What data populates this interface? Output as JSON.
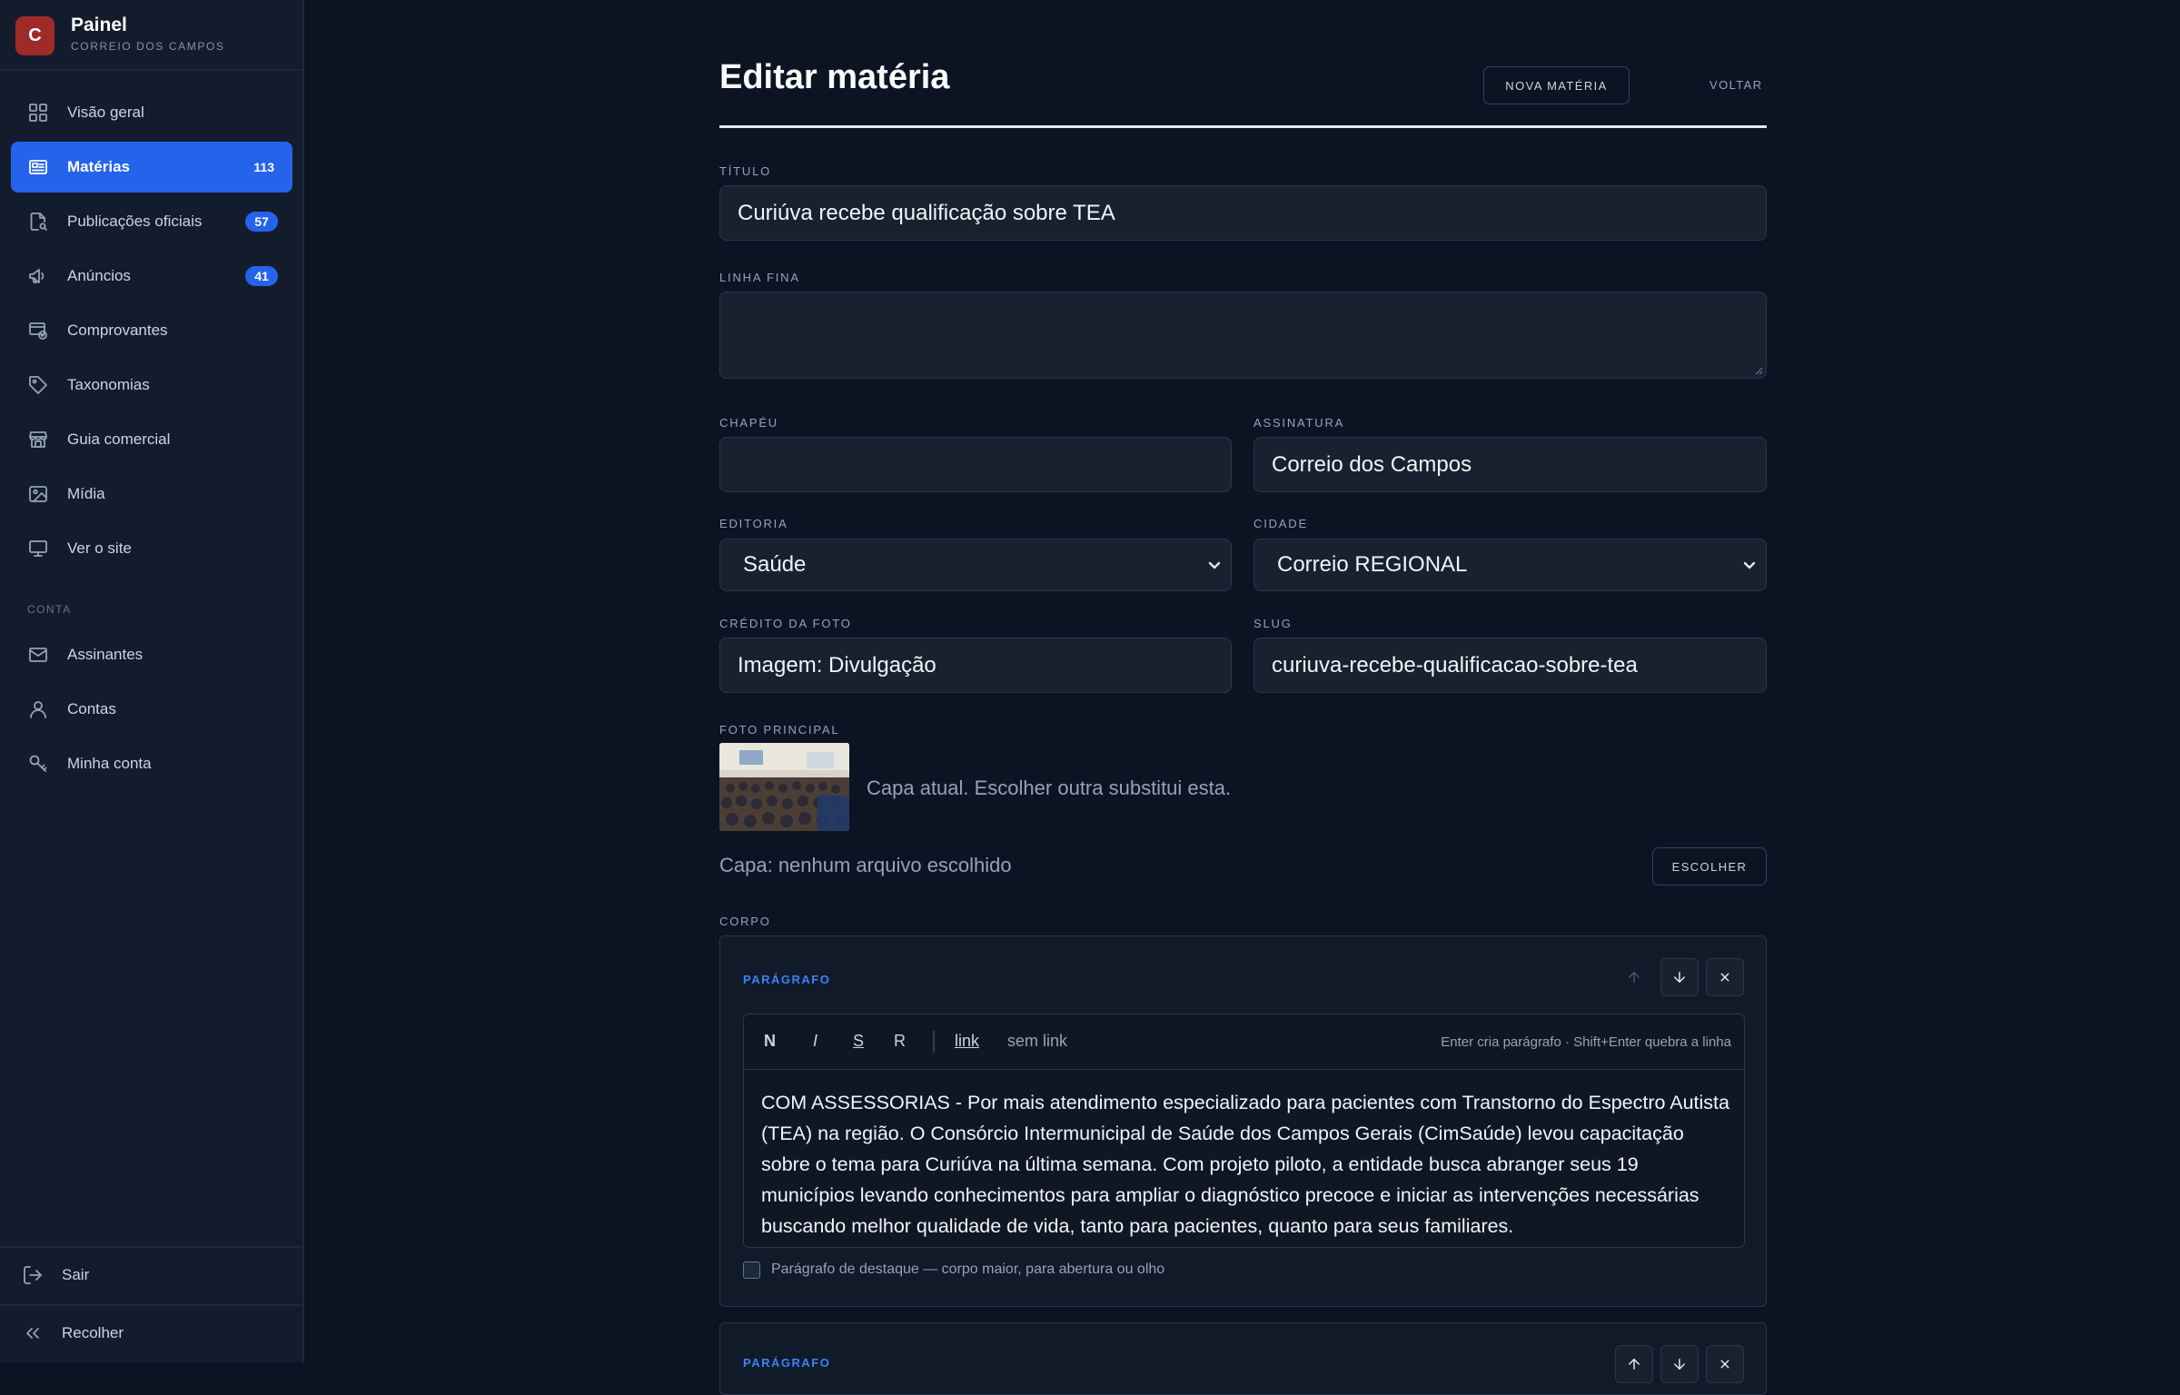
{
  "sidebar": {
    "brand": {
      "logo_letter": "C",
      "title": "Painel",
      "subtitle": "CORREIO DOS CAMPOS"
    },
    "items": [
      {
        "label": "Visão geral",
        "icon": "grid-icon"
      },
      {
        "label": "Matérias",
        "icon": "newspaper-icon",
        "badge": "113",
        "active": true
      },
      {
        "label": "Publicações oficiais",
        "icon": "document-search-icon",
        "badge": "57"
      },
      {
        "label": "Anúncios",
        "icon": "megaphone-icon",
        "badge": "41"
      },
      {
        "label": "Comprovantes",
        "icon": "receipt-icon"
      },
      {
        "label": "Taxonomias",
        "icon": "tag-icon"
      },
      {
        "label": "Guia comercial",
        "icon": "store-icon"
      },
      {
        "label": "Mídia",
        "icon": "image-icon"
      },
      {
        "label": "Ver o site",
        "icon": "monitor-icon"
      }
    ],
    "section_conta": "CONTA",
    "conta_items": [
      {
        "label": "Assinantes",
        "icon": "mail-icon"
      },
      {
        "label": "Contas",
        "icon": "user-icon"
      },
      {
        "label": "Minha conta",
        "icon": "key-icon"
      }
    ],
    "logout": "Sair",
    "collapse": "Recolher"
  },
  "page": {
    "title": "Editar matéria",
    "new_button": "NOVA MATÉRIA",
    "back_button": "VOLTAR"
  },
  "form": {
    "titulo": {
      "label": "TÍTULO",
      "value": "Curiúva recebe qualificação sobre TEA"
    },
    "linha_fina": {
      "label": "LINHA FINA",
      "value": ""
    },
    "chapeu": {
      "label": "CHAPÉU",
      "value": ""
    },
    "assinatura": {
      "label": "ASSINATURA",
      "value": "Correio dos Campos"
    },
    "editoria": {
      "label": "EDITORIA",
      "value": "Saúde"
    },
    "cidade": {
      "label": "CIDADE",
      "value": "Correio REGIONAL"
    },
    "credito": {
      "label": "CRÉDITO DA FOTO",
      "value": "Imagem: Divulgação"
    },
    "slug": {
      "label": "SLUG",
      "value": "curiuva-recebe-qualificacao-sobre-tea"
    },
    "foto": {
      "label": "FOTO PRINCIPAL",
      "caption": "Capa atual. Escolher outra substitui esta.",
      "file_status": "Capa: nenhum arquivo escolhido",
      "choose_button": "ESCOLHER"
    },
    "corpo": {
      "label": "CORPO",
      "block_label": "PARÁGRAFO",
      "toolbar": {
        "bold": "N",
        "italic": "I",
        "strike": "S",
        "remove": "R",
        "link": "link",
        "unlink": "sem link",
        "hint": "Enter cria parágrafo · Shift+Enter quebra a linha"
      },
      "text": "COM ASSESSORIAS - Por mais atendimento especializado para pacientes com Transtorno do Espectro Autista (TEA) na região. O Consórcio Intermunicipal de Saúde dos Campos Gerais (CimSaúde) levou capacitação sobre o tema para Curiúva na última semana. Com projeto piloto, a entidade busca abranger seus 19 municípios levando conhecimentos para ampliar o diagnóstico precoce e iniciar as intervenções necessárias buscando melhor qualidade de vida, tanto para pacientes, quanto para seus familiares.",
      "highlight_label": "Parágrafo de destaque — corpo maior, para abertura ou olho",
      "next_block_label": "PARÁGRAFO"
    }
  },
  "colors": {
    "accent": "#2563eb",
    "brand": "#9f2a2a",
    "bg": "#0c1424",
    "sidebar": "#131c2c"
  }
}
